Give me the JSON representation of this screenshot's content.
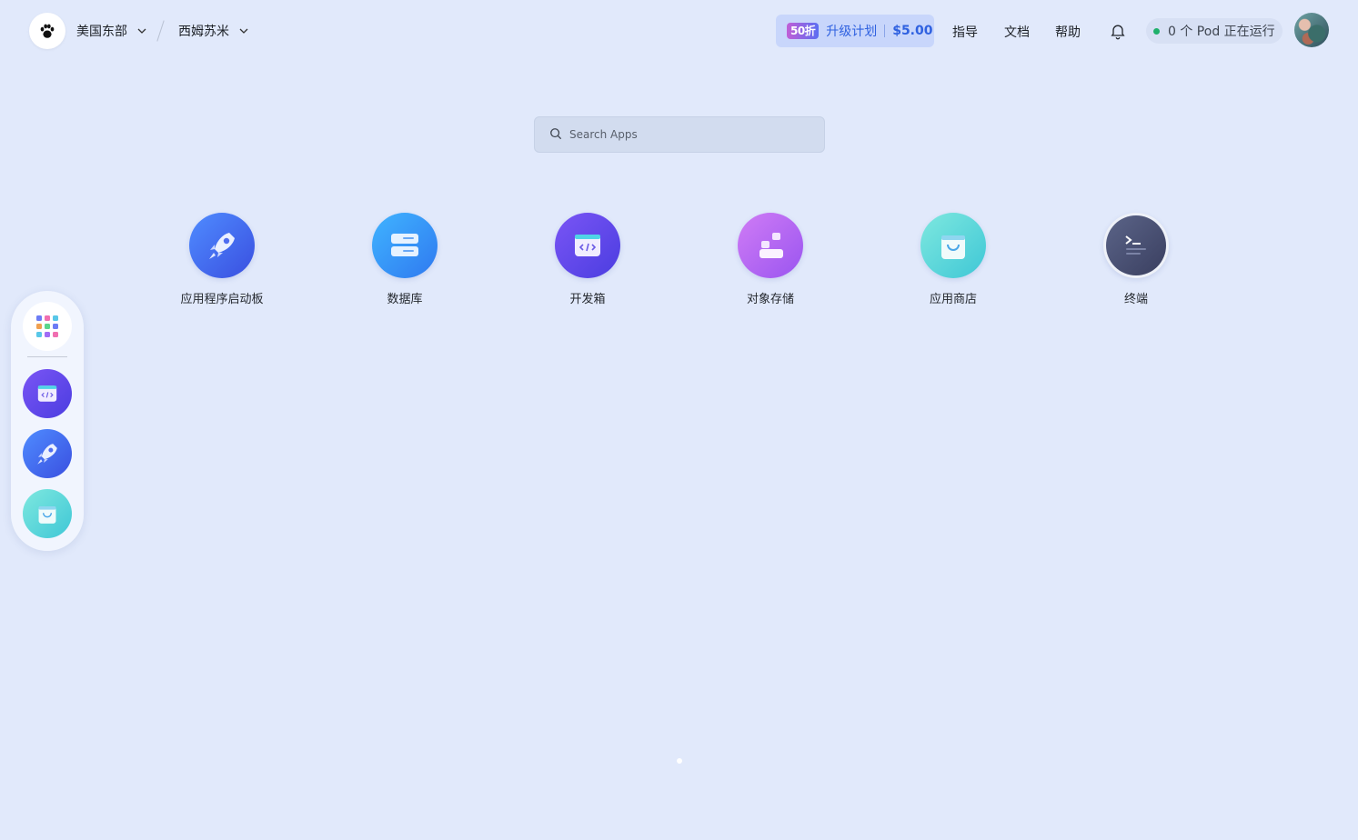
{
  "header": {
    "region": "美国东部",
    "workspace": "西姆苏米",
    "upgrade": {
      "badge": "50折",
      "label": "升级计划",
      "price": "$5.00"
    },
    "links": [
      "指导",
      "文档",
      "帮助"
    ],
    "pod_status": "0 个 Pod 正在运行"
  },
  "search": {
    "placeholder": "Search Apps"
  },
  "apps": [
    {
      "label": "应用程序启动板",
      "icon": "rocket-icon"
    },
    {
      "label": "数据库",
      "icon": "database-icon"
    },
    {
      "label": "开发箱",
      "icon": "devbox-icon"
    },
    {
      "label": "对象存储",
      "icon": "object-storage-icon"
    },
    {
      "label": "应用商店",
      "icon": "shopping-bag-icon"
    },
    {
      "label": "终端",
      "icon": "terminal-icon"
    }
  ],
  "dock": {
    "items": [
      "apps-grid-icon",
      "devbox-icon",
      "rocket-icon",
      "shopping-bag-icon"
    ]
  },
  "colors": {
    "background": "#e1e9fb",
    "accent": "#2f61e0",
    "status_running": "#1fb06b"
  }
}
